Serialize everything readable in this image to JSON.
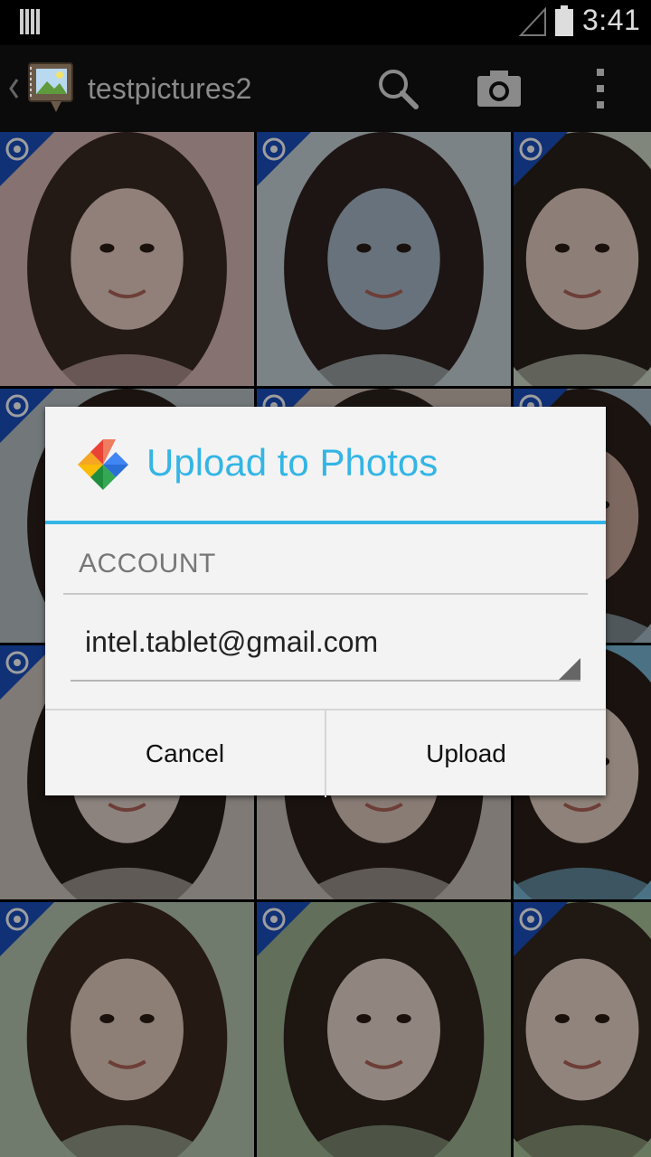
{
  "status_bar": {
    "time": "3:41"
  },
  "action_bar": {
    "title": "testpictures2",
    "icons": [
      "up-caret-icon",
      "album-icon",
      "search-icon",
      "camera-icon",
      "overflow-menu-icon"
    ]
  },
  "grid": {
    "columns": 3,
    "rows": 4,
    "tile_badge_icon": "picasa-sync-icon"
  },
  "dialog": {
    "title": "Upload to Photos",
    "icon": "google-photos-pinwheel-icon",
    "section_label": "ACCOUNT",
    "account_value": "intel.tablet@gmail.com",
    "cancel_label": "Cancel",
    "upload_label": "Upload"
  },
  "colors": {
    "accent": "#33b5e5",
    "dialog_bg": "#f3f3f3",
    "badge_blue": "#1a4fbf"
  }
}
